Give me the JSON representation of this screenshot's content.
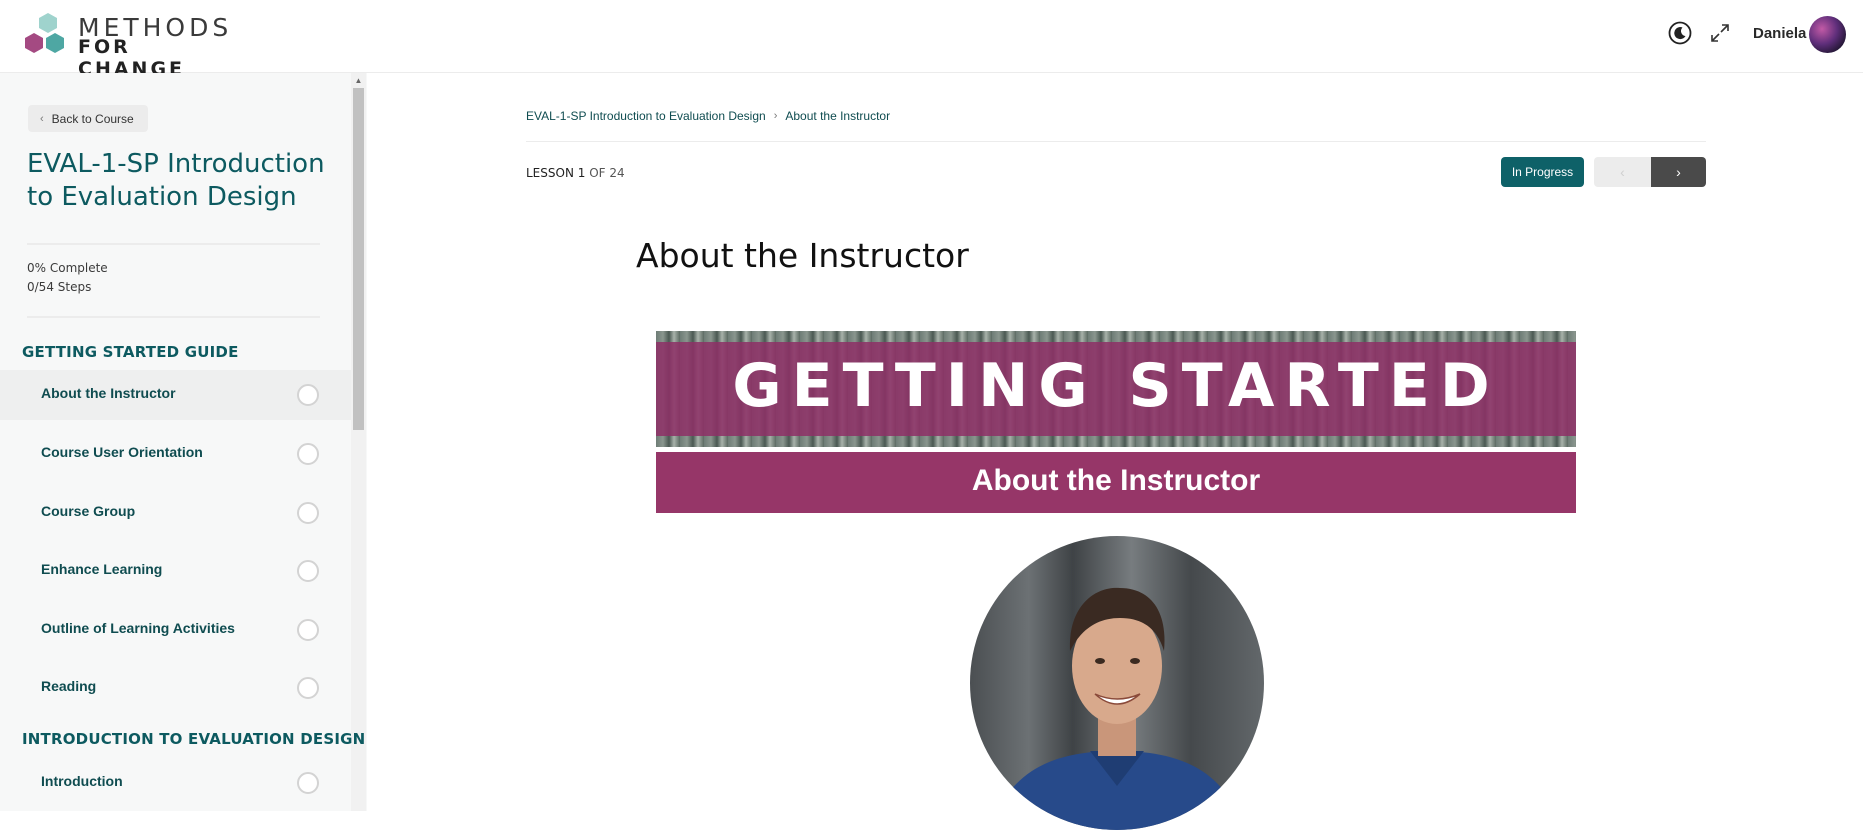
{
  "header": {
    "logo_line1": "METHODS",
    "logo_line2": "FOR CHANGE",
    "user_name": "Daniela",
    "icons": [
      "theme-toggle-icon",
      "fullscreen-icon"
    ]
  },
  "sidebar": {
    "back_label": "Back to Course",
    "course_title": "EVAL-1-SP Introduction to Evaluation Design",
    "progress_percent": "0% Complete",
    "progress_steps": "0/54 Steps",
    "sections": [
      {
        "heading": "GETTING STARTED GUIDE",
        "lessons": [
          {
            "label": "About the Instructor",
            "active": true
          },
          {
            "label": "Course User Orientation",
            "active": false
          },
          {
            "label": "Course Group",
            "active": false
          },
          {
            "label": "Enhance Learning",
            "active": false
          },
          {
            "label": "Outline of Learning Activities",
            "active": false
          },
          {
            "label": "Reading",
            "active": false
          }
        ]
      },
      {
        "heading": "INTRODUCTION TO EVALUATION DESIGN",
        "lessons": [
          {
            "label": "Introduction",
            "active": false
          }
        ]
      }
    ]
  },
  "main": {
    "breadcrumb": [
      "EVAL-1-SP Introduction to Evaluation Design",
      "About the Instructor"
    ],
    "lesson_prefix": "LESSON",
    "lesson_number": "1",
    "lesson_total": "OF 24",
    "status_label": "In Progress",
    "page_title": "About the Instructor",
    "banner_top_text": "GETTING STARTED",
    "banner_bottom_text": "About the Instructor"
  },
  "colors": {
    "accent": "#0e6168",
    "banner_magenta": "#963668",
    "sidebar_bg": "#f7f8f8"
  }
}
